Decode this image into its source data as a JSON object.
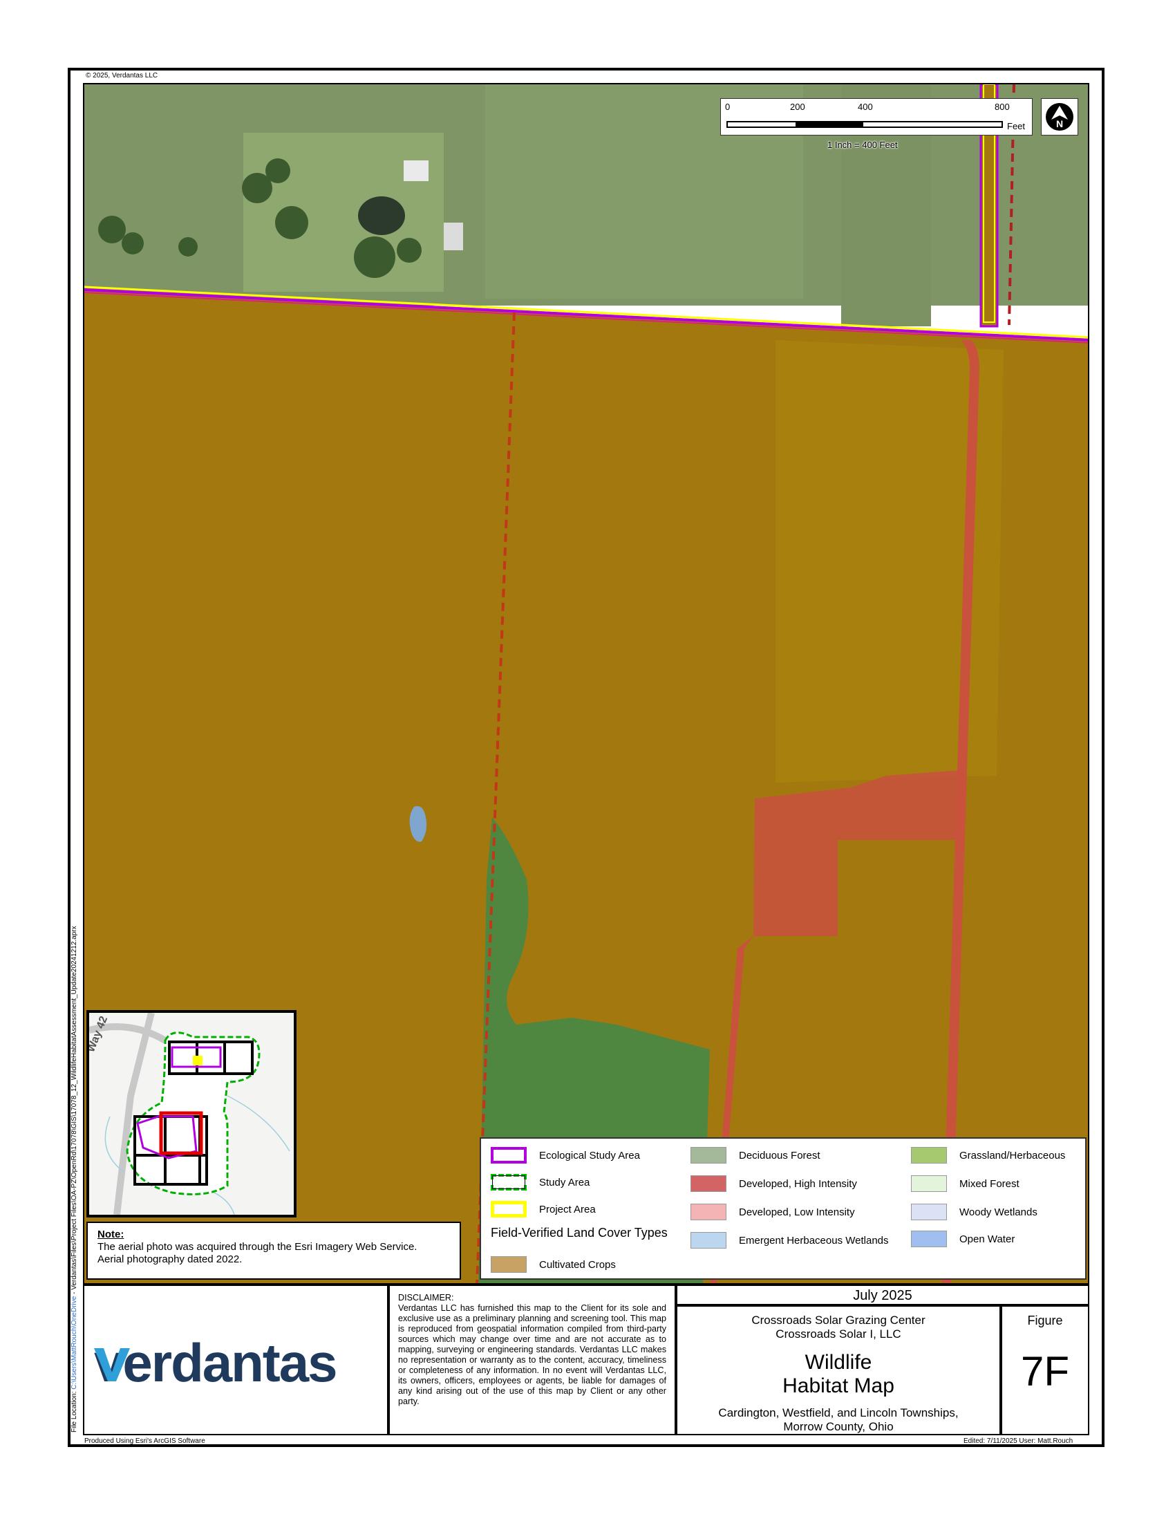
{
  "copyright": "© 2025, Verdantas LLC",
  "scalebar": {
    "ticks": [
      "0",
      "200",
      "400",
      "800"
    ],
    "unit": "Feet",
    "ratio_text": "1 Inch = 400 Feet"
  },
  "north_arrow": {
    "icon": "north-arrow-icon",
    "label": "N"
  },
  "note": {
    "title": "Note:",
    "line1": "The aerial photo was acquired through the Esri Imagery Web Service.",
    "line2": "Aerial photography dated 2022."
  },
  "inset": {
    "road_label": "Way 42"
  },
  "legend": {
    "items": [
      {
        "label": "Ecological Study Area",
        "color": "#b200e0"
      },
      {
        "label": "Study Area",
        "color": "#00c000"
      },
      {
        "label": "Project Area",
        "color": "#ffff00"
      },
      {
        "label": "Deciduous Forest",
        "color": "#a4b89a"
      },
      {
        "label": "Developed, High Intensity",
        "color": "#d26466"
      },
      {
        "label": "Developed, Low Intensity",
        "color": "#f4b4b6"
      },
      {
        "label": "Emergent Herbaceous Wetlands",
        "color": "#bcd6f0"
      },
      {
        "label": "Grassland/Herbaceous",
        "color": "#a6c86e"
      },
      {
        "label": "Mixed Forest",
        "color": "#e2f4da"
      },
      {
        "label": "Woody Wetlands",
        "color": "#dce2f6"
      },
      {
        "label": "Open Water",
        "color": "#a0bff0"
      },
      {
        "label": "Cultivated Crops",
        "color": "#c8a264"
      }
    ],
    "heading": "Field-Verified Land Cover Types"
  },
  "company": {
    "name": "verdantas"
  },
  "disclaimer": {
    "title": "DISCLAIMER:",
    "body": "Verdantas LLC has furnished this map to the Client for its sole and exclusive use as a preliminary planning and screening tool. This map is reproduced from geospatial information compiled from third-party sources which may change over time and are not accurate as to mapping, surveying or engineering standards. Verdantas LLC makes no representation or warranty as to the content, accuracy, timeliness or completeness of any information. In no event will Verdantas LLC, its owners, officers, employees or agents, be liable for damages of any kind arising out of the use of this map by Client or any other party."
  },
  "titleblock": {
    "date": "July 2025",
    "project_line1": "Crossroads Solar Grazing Center",
    "project_line2": "Crossroads Solar I, LLC",
    "title_line1": "Wildlife",
    "title_line2": "Habitat Map",
    "location_line1": "Cardington, Westfield, and Lincoln Townships,",
    "location_line2": "Morrow County, Ohio",
    "figure_label": "Figure",
    "figure_number": "7F"
  },
  "footer": {
    "produced": "Produced Using Esri's ArcGIS Software",
    "edited": "Edited: 7/11/2025   User: Matt.Rouch"
  },
  "file_location": {
    "label": "File Location:",
    "path_link": "C:\\Users\\MattRouch\\OneDrive",
    "path_rest": " - Verdantas\\Files\\Project Files\\OA-PZ\\OpenRd\\17078\\GIS\\17078_12_WildlifeHabitatAssessment_Update20241212.aprx"
  }
}
